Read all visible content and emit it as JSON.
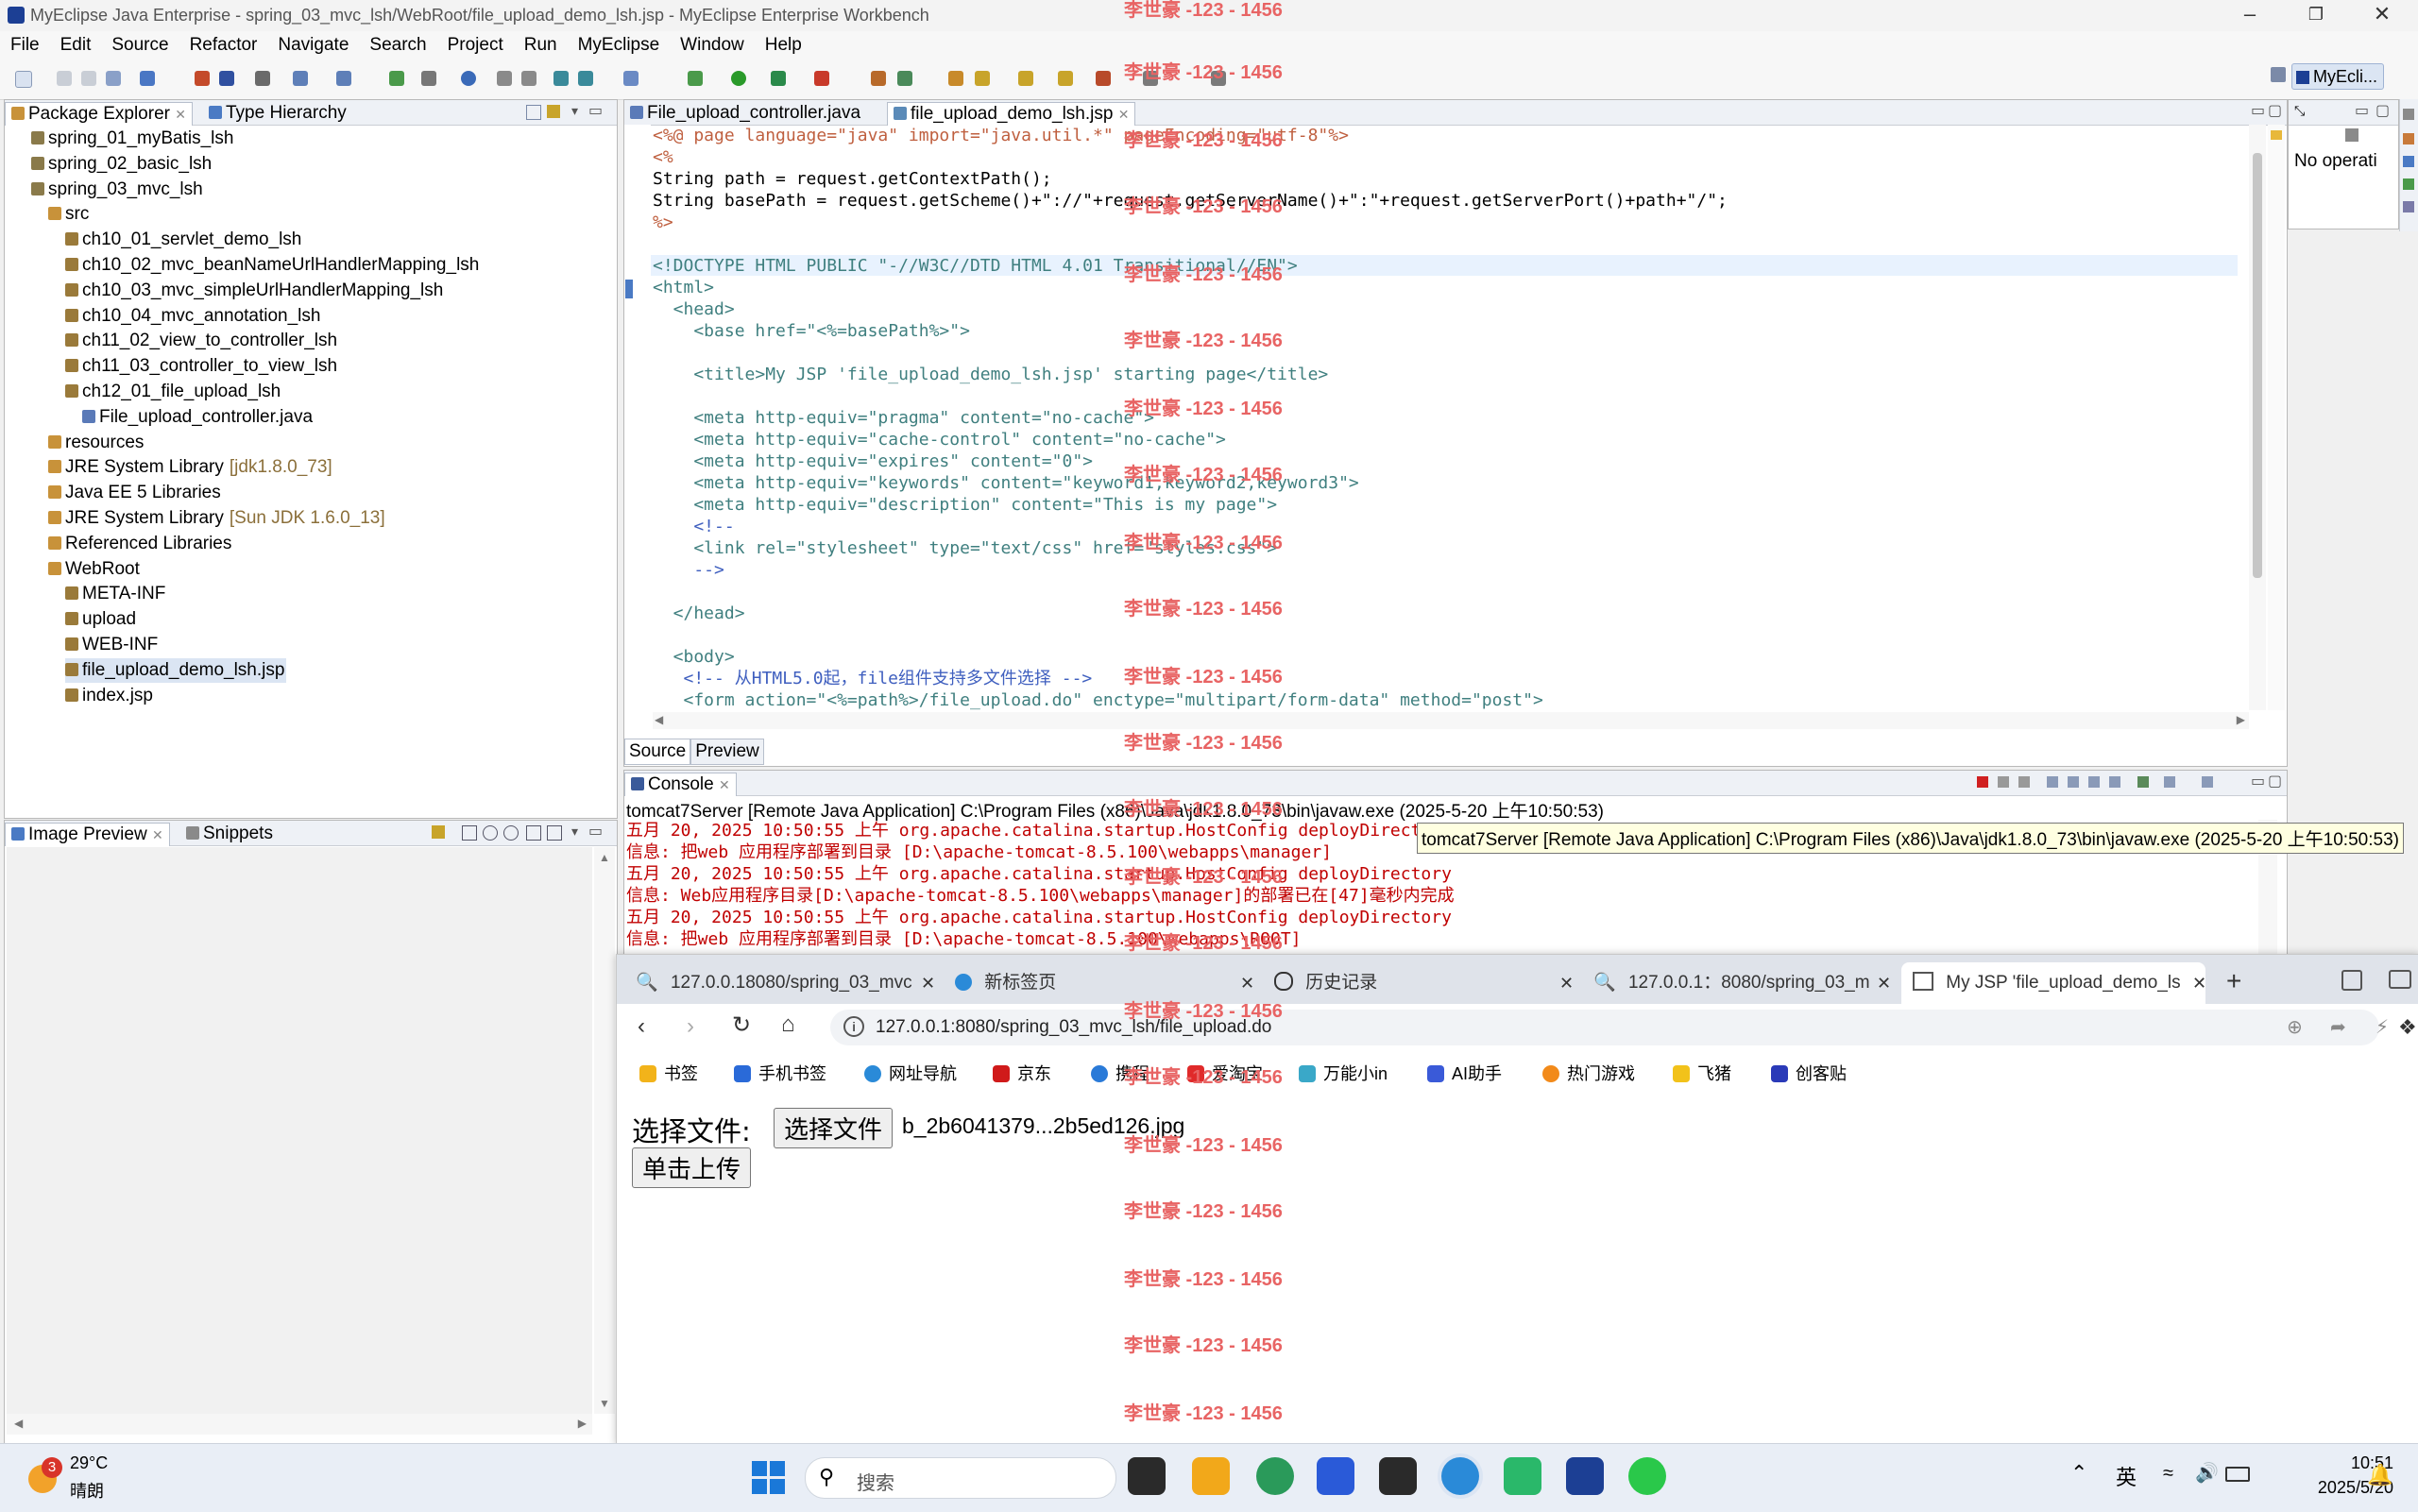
{
  "window": {
    "title": "MyEclipse Java Enterprise - spring_03_mvc_lsh/WebRoot/file_upload_demo_lsh.jsp - MyEclipse Enterprise Workbench"
  },
  "menu": [
    "File",
    "Edit",
    "Source",
    "Refactor",
    "Navigate",
    "Search",
    "Project",
    "Run",
    "MyEclipse",
    "Window",
    "Help"
  ],
  "perspective": {
    "label": "MyEcli..."
  },
  "package_explorer": {
    "tabs": [
      "Package Explorer",
      "Type Hierarchy"
    ],
    "items": [
      {
        "label": "spring_01_myBatis_lsh",
        "indent": 0
      },
      {
        "label": "spring_02_basic_lsh",
        "indent": 0
      },
      {
        "label": "spring_03_mvc_lsh",
        "indent": 0
      },
      {
        "label": "src",
        "indent": 1
      },
      {
        "label": "ch10_01_servlet_demo_lsh",
        "indent": 2
      },
      {
        "label": "ch10_02_mvc_beanNameUrlHandlerMapping_lsh",
        "indent": 2
      },
      {
        "label": "ch10_03_mvc_simpleUrlHandlerMapping_lsh",
        "indent": 2
      },
      {
        "label": "ch10_04_mvc_annotation_lsh",
        "indent": 2
      },
      {
        "label": "ch11_02_view_to_controller_lsh",
        "indent": 2
      },
      {
        "label": "ch11_03_controller_to_view_lsh",
        "indent": 2
      },
      {
        "label": "ch12_01_file_upload_lsh",
        "indent": 2
      },
      {
        "label": "File_upload_controller.java",
        "indent": 3
      },
      {
        "label": "resources",
        "indent": 1
      },
      {
        "label": "JRE System Library",
        "suffix": "[jdk1.8.0_73]",
        "indent": 1
      },
      {
        "label": "Java EE 5 Libraries",
        "indent": 1
      },
      {
        "label": "JRE System Library",
        "suffix": "[Sun JDK 1.6.0_13]",
        "indent": 1
      },
      {
        "label": "Referenced Libraries",
        "indent": 1
      },
      {
        "label": "WebRoot",
        "indent": 1
      },
      {
        "label": "META-INF",
        "indent": 2
      },
      {
        "label": "upload",
        "indent": 2
      },
      {
        "label": "WEB-INF",
        "indent": 2
      },
      {
        "label": "file_upload_demo_lsh.jsp",
        "indent": 2,
        "selected": true
      },
      {
        "label": "index.jsp",
        "indent": 2
      }
    ]
  },
  "image_preview": {
    "tabs": [
      "Image Preview",
      "Snippets"
    ]
  },
  "outline": {
    "text": "No operati"
  },
  "editor": {
    "tabs": [
      "File_upload_controller.java",
      "file_upload_demo_lsh.jsp"
    ],
    "bottom_tabs": [
      "Source",
      "Preview"
    ],
    "lines": [
      "<%@ page language=\"java\" import=\"java.util.*\" pageEncoding=\"utf-8\"%>",
      "<%",
      "String path = request.getContextPath();",
      "String basePath = request.getScheme()+\"://\"+request.getServerName()+\":\"+request.getServerPort()+path+\"/\";",
      "%>",
      "",
      "<!DOCTYPE HTML PUBLIC \"-//W3C//DTD HTML 4.01 Transitional//EN\">",
      "<html>",
      "  <head>",
      "    <base href=\"<%=basePath%>\">",
      "",
      "    <title>My JSP 'file_upload_demo_lsh.jsp' starting page</title>",
      "",
      "    <meta http-equiv=\"pragma\" content=\"no-cache\">",
      "    <meta http-equiv=\"cache-control\" content=\"no-cache\">",
      "    <meta http-equiv=\"expires\" content=\"0\">",
      "    <meta http-equiv=\"keywords\" content=\"keyword1,keyword2,keyword3\">",
      "    <meta http-equiv=\"description\" content=\"This is my page\">",
      "    <!--",
      "    <link rel=\"stylesheet\" type=\"text/css\" href=\"styles.css\">",
      "    -->",
      "",
      "  </head>",
      "",
      "  <body>",
      "   <!-- 从HTML5.0起，file组件支持多文件选择 -->",
      "   <form action=\"<%=path%>/file_upload.do\" enctype=\"multipart/form-data\" method=\"post\">"
    ]
  },
  "console": {
    "tab": "Console",
    "header": "tomcat7Server [Remote Java Application] C:\\Program Files (x86)\\Java\\jdk1.8.0_73\\bin\\javaw.exe (2025-5-20 上午10:50:53)",
    "tooltip": "tomcat7Server [Remote Java Application] C:\\Program Files (x86)\\Java\\jdk1.8.0_73\\bin\\javaw.exe (2025-5-20 上午10:50:53)",
    "lines": [
      "五月 20, 2025 10:50:55 上午 org.apache.catalina.startup.HostConfig deployDirecto",
      "信息: 把web 应用程序部署到目录 [D:\\apache-tomcat-8.5.100\\webapps\\manager]",
      "五月 20, 2025 10:50:55 上午 org.apache.catalina.startup.HostConfig deployDirectory",
      "信息: Web应用程序目录[D:\\apache-tomcat-8.5.100\\webapps\\manager]的部署已在[47]毫秒内完成",
      "五月 20, 2025 10:50:55 上午 org.apache.catalina.startup.HostConfig deployDirectory",
      "信息: 把web 应用程序部署到目录 [D:\\apache-tomcat-8.5.100\\webapps\\ROOT]"
    ]
  },
  "browser": {
    "tabs": [
      {
        "label": "127.0.0.18080/spring_03_mvc",
        "active": false
      },
      {
        "label": "新标签页",
        "active": false
      },
      {
        "label": "历史记录",
        "active": false
      },
      {
        "label": "127.0.0.1：8080/spring_03_m",
        "active": false
      },
      {
        "label": "My JSP 'file_upload_demo_ls",
        "active": true
      }
    ],
    "url": "127.0.0.1:8080/spring_03_mvc_lsh/file_upload.do",
    "bookmarks": [
      "书签",
      "手机书签",
      "网址导航",
      "京东",
      "携程",
      "爱淘宝",
      "万能小in",
      "AI助手",
      "热门游戏",
      "飞猪",
      "创客贴"
    ],
    "page": {
      "label": "选择文件:",
      "choose_button": "选择文件",
      "file_name": "b_2b6041379...2b5ed126.jpg",
      "upload_button": "单击上传"
    }
  },
  "watermark": "李世豪 -123 - 1456",
  "taskbar": {
    "weather_temp": "29°C",
    "weather_desc": "晴朗",
    "weather_badge": "3",
    "search_placeholder": "搜索",
    "ime": "英",
    "time": "10:51",
    "date": "2025/5/20"
  },
  "colors": {
    "accent": "#0067c0",
    "watermark": "#e86464",
    "selection": "#dbe5f3"
  }
}
